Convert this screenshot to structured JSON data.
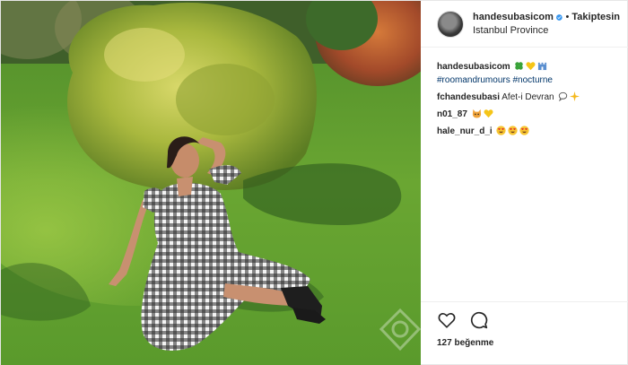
{
  "post": {
    "username": "handesubasicom",
    "follow_separator": "•",
    "follow_label": "Takiptesin",
    "location": "Istanbul Province",
    "caption": {
      "user": "handesubasicom",
      "hashtags": [
        "#roomandrumours",
        "#nocturne"
      ],
      "emoji_icons": [
        "four-leaf-clover-icon",
        "yellow-heart-icon",
        "castle-icon"
      ]
    },
    "comments": [
      {
        "user": "fchandesubasi",
        "text": "Afet-i Devran",
        "emoji_icons": [
          "speech-bubble-icon",
          "sparkle-icon"
        ]
      },
      {
        "user": "n01_87",
        "text": "",
        "emoji_icons": [
          "cat-face-icon",
          "yellow-heart-icon"
        ]
      },
      {
        "user": "hale_nur_d_i",
        "text": "",
        "emoji_icons": [
          "heart-eyes-icon",
          "heart-eyes-icon",
          "heart-eyes-icon"
        ]
      }
    ],
    "likes_text": "127 beğenme"
  },
  "colors": {
    "verified_blue": "#3897f0",
    "hashtag_blue": "#003569",
    "grass_green": "#5e9a2a",
    "tree_green": "#9bb43a"
  }
}
